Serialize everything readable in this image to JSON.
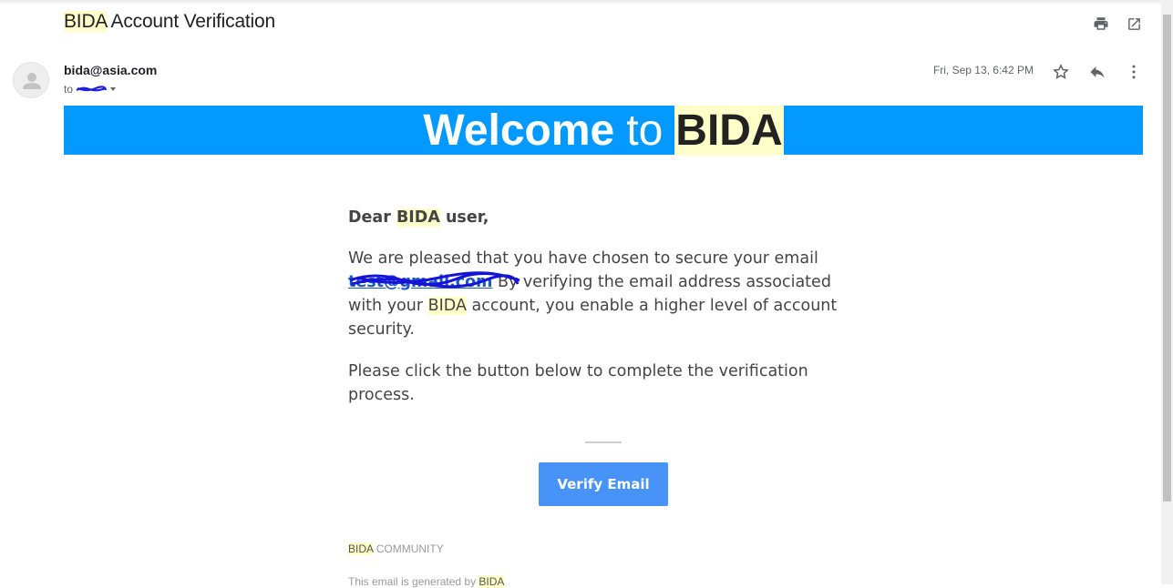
{
  "subject": {
    "brand": "BIDA",
    "rest": "Account Verification"
  },
  "toolbar": {
    "print_icon": "print-icon",
    "popout_icon": "open-in-new-window-icon"
  },
  "message": {
    "sender": "bida@asia.com",
    "to_label": "to",
    "date": "Fri, Sep 13, 6:42 PM",
    "icons": [
      "star-icon",
      "reply-icon",
      "more-vert-icon"
    ]
  },
  "banner": {
    "word1": "Welcome",
    "word2": "to",
    "brand": "BIDA",
    "bg_color": "#0399ff"
  },
  "email_body": {
    "greeting_pre": "Dear",
    "greeting_brand": "BIDA",
    "greeting_post": "user,",
    "p1_a": "We are pleased that you have chosen to secure your email",
    "p1_link": "test@gmail.com",
    "p1_b": "By verifying the email address associated with your",
    "p1_brand": "BIDA",
    "p1_c": "account,  you enable a higher level of account security.",
    "p2": "Please click the button below to complete the verification process."
  },
  "button": {
    "label": "Verify Email",
    "color": "#4893f7"
  },
  "footer": {
    "brand": "BIDA",
    "community": "COMMUNITY",
    "generated_by": "This email is generated by",
    "brand2": "BIDA"
  }
}
